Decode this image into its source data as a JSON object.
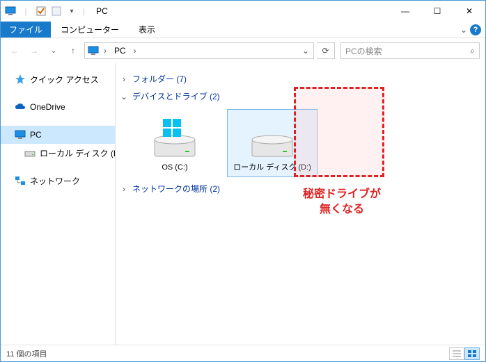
{
  "window": {
    "title": "PC",
    "minimize": "—",
    "maximize": "☐",
    "close": "✕"
  },
  "ribbon": {
    "file": "ファイル",
    "tab1": "コンピューター",
    "tab2": "表示",
    "expand": "⌄",
    "help": "?"
  },
  "nav": {
    "back": "←",
    "forward": "→",
    "recent": "⌄",
    "up": "↑",
    "location": "PC",
    "chevron": "›",
    "dropdown": "⌄",
    "refresh": "⟳",
    "search_placeholder": "PCの検索",
    "search_icon": "⌕"
  },
  "sidebar": {
    "items": [
      {
        "label": "クイック アクセス"
      },
      {
        "label": "OneDrive"
      },
      {
        "label": "PC"
      },
      {
        "label": "ローカル ディスク (D:)"
      },
      {
        "label": "ネットワーク"
      }
    ]
  },
  "groups": {
    "folders": {
      "arrow": "›",
      "label": "フォルダー (7)"
    },
    "drives": {
      "arrow": "⌄",
      "label": "デバイスとドライブ (2)"
    },
    "network": {
      "arrow": "›",
      "label": "ネットワークの場所 (2)"
    }
  },
  "drives": [
    {
      "label": "OS (C:)"
    },
    {
      "label": "ローカル ディスク (D:)"
    }
  ],
  "annotation": {
    "text": "秘密ドライブが\n無くなる"
  },
  "status": {
    "count": "11 個の項目"
  }
}
